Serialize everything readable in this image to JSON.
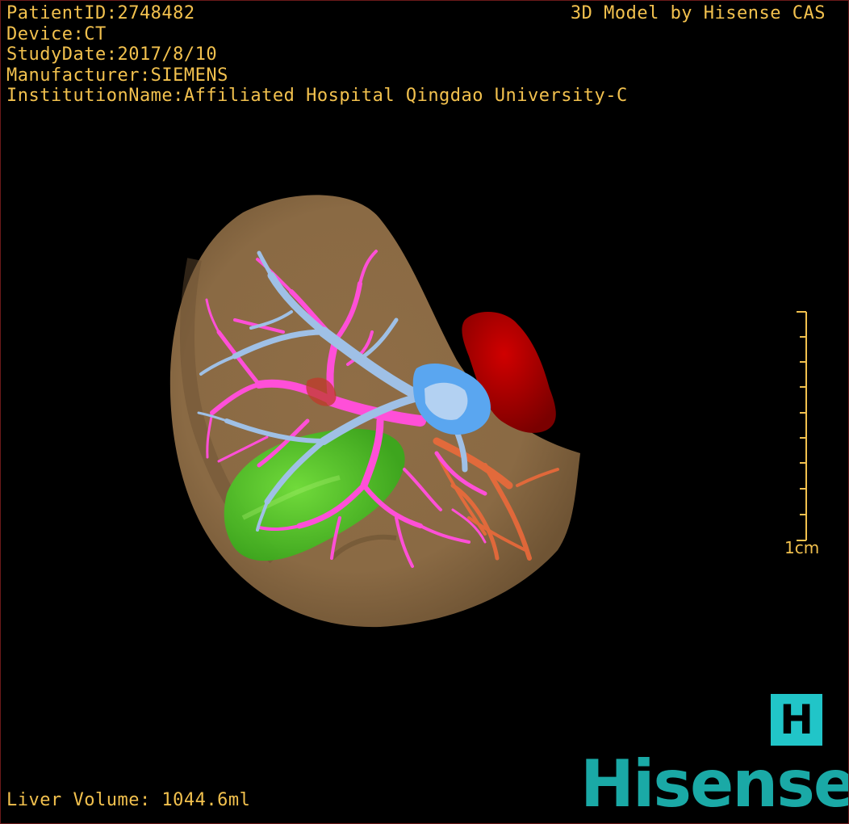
{
  "overlay": {
    "patient_id": "PatientID:2748482",
    "device": "Device:CT",
    "study_date": "StudyDate:2017/8/10",
    "manufacturer": "Manufacturer:SIEMENS",
    "institution": "InstitutionName:Affiliated Hospital Qingdao University-C",
    "credit": "3D Model by Hisense CAS",
    "liver_volume": "Liver Volume: 1044.6ml"
  },
  "scale_bar": {
    "label": "1cm"
  },
  "logo": {
    "letter": "H",
    "brand": "Hisense"
  },
  "colors": {
    "text": "#f2c14e",
    "background": "#000000",
    "liver": "#8c6a45",
    "portal_vein": "#ff4fd8",
    "hepatic_vein": "#9fc0e6",
    "ivc_blue": "#5aa6f0",
    "aorta": "#b00000",
    "gallbladder": "#55cc22",
    "artery_orange": "#f26a3a",
    "brand": "#1aa9a6"
  },
  "structures": [
    "liver",
    "portal-vein",
    "hepatic-vein",
    "inferior-vena-cava",
    "aorta",
    "gallbladder",
    "hepatic-artery"
  ]
}
